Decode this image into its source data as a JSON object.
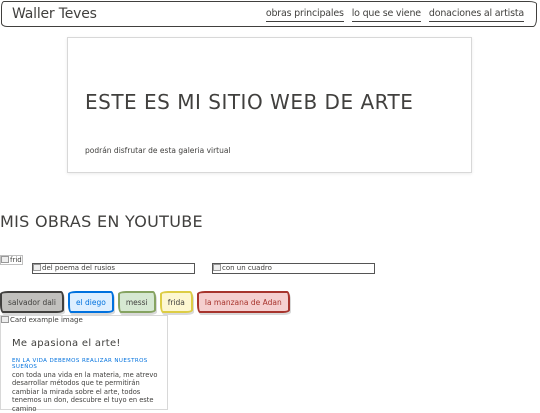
{
  "navbar": {
    "brand": "Waller Teves",
    "links": [
      {
        "label": "obras principales"
      },
      {
        "label": "lo que se viene"
      },
      {
        "label": "donaciones al artista"
      }
    ]
  },
  "hero": {
    "title": "ESTE ES MI SITIO WEB DE ARTE",
    "subtitle": "podrán disfrutar de esta galeria virtual"
  },
  "youtube_section": {
    "heading": "MIS OBRAS EN YOUTUBE"
  },
  "images": {
    "frida_alt": "frida",
    "poema_alt": "del poema del rusios",
    "cuadro_alt": "con un cuadro"
  },
  "buttons": [
    {
      "label": "salvador dali",
      "color": "#c1c0bd"
    },
    {
      "label": "el diego",
      "color": "#deefff"
    },
    {
      "label": "messi",
      "color": "#d6e8d2"
    },
    {
      "label": "frida",
      "color": "#fdf7d1"
    },
    {
      "label": "la manzana de Adan",
      "color": "#f5cfcf"
    }
  ],
  "card": {
    "image_alt": "Card example image",
    "title": "Me apasiona el arte!",
    "subtitle": "EN LA VIDA DEBEMOS REALIZAR NUESTROS SUEÑOS",
    "text": "con toda una vida en la materia, me atrevo desarrollar métodos que te permitirán cambiar la mirada sobre el arte, todos tenemos un don, descubre el tuyo en este camino"
  },
  "colors": {
    "text": "#41403e",
    "accent_blue": "#0071de",
    "accent_red": "#a7342d"
  }
}
